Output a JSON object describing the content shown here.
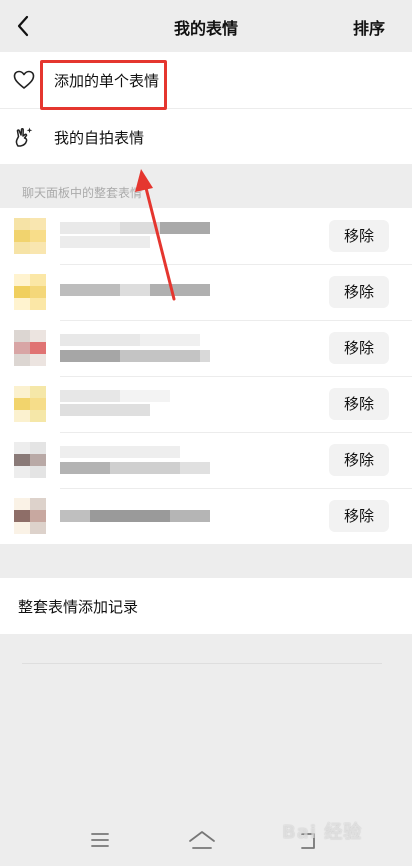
{
  "header": {
    "title": "我的表情",
    "sort_label": "排序"
  },
  "top_items": [
    {
      "label": "添加的单个表情",
      "icon": "heart-outline-icon"
    },
    {
      "label": "我的自拍表情",
      "icon": "selfie-hand-sparkle-icon"
    }
  ],
  "section_caption": "聊天面板中的整套表情",
  "sticker_sets": [
    {
      "remove_label": "移除",
      "thumb_colors": [
        "#f6e3a6",
        "#f9e6b0",
        "#f1d36e",
        "#f8dd8a"
      ]
    },
    {
      "remove_label": "移除",
      "thumb_colors": [
        "#fff3cf",
        "#fbe7a6",
        "#f0cf5e",
        "#f4d77a"
      ]
    },
    {
      "remove_label": "移除",
      "thumb_colors": [
        "#dcd6d2",
        "#ece4e0",
        "#d8a5a5",
        "#e07373"
      ]
    },
    {
      "remove_label": "移除",
      "thumb_colors": [
        "#fbf1cf",
        "#f5e7a8",
        "#f2d46c",
        "#f6dd8a"
      ]
    },
    {
      "remove_label": "移除",
      "thumb_colors": [
        "#ededed",
        "#e4e4e4",
        "#8a7a78",
        "#b9a9a6"
      ]
    },
    {
      "remove_label": "移除",
      "thumb_colors": [
        "#faf2e6",
        "#ddd2cb",
        "#8e6e68",
        "#c8a8a0"
      ]
    }
  ],
  "record_label": "整套表情添加记录",
  "annotation": {
    "highlight_color": "#e5362f"
  },
  "watermark": "Bai 经验"
}
